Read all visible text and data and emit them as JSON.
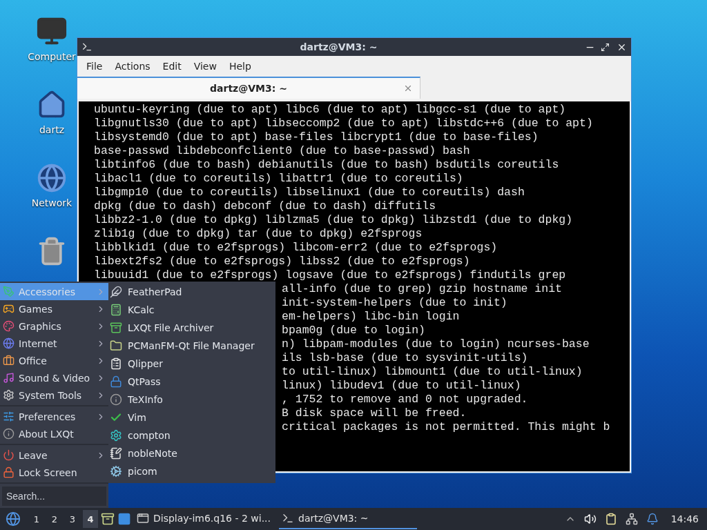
{
  "desktop_icons": [
    {
      "label": "Computer",
      "kind": "computer"
    },
    {
      "label": "dartz",
      "kind": "home"
    },
    {
      "label": "Network",
      "kind": "network"
    },
    {
      "kind": "trash"
    }
  ],
  "window": {
    "title": "dartz@VM3: ~",
    "menu": [
      "File",
      "Actions",
      "Edit",
      "View",
      "Help"
    ],
    "tabs": [
      {
        "label": "dartz@VM3: ~",
        "selected": true
      }
    ],
    "terminal": [
      {
        "text": "ubuntu-keyring (due to apt) libc6 (due to apt) libgcc-s1 (due to apt)",
        "kind": "full"
      },
      {
        "text": "libgnutls30 (due to apt) libseccomp2 (due to apt) libstdc++6 (due to apt)",
        "kind": "full"
      },
      {
        "text": "libsystemd0 (due to apt) base-files libcrypt1 (due to base-files)",
        "kind": "full"
      },
      {
        "text": "base-passwd libdebconfclient0 (due to base-passwd) bash",
        "kind": "full"
      },
      {
        "text": "libtinfo6 (due to bash) debianutils (due to bash) bsdutils coreutils",
        "kind": "full"
      },
      {
        "text": "libacl1 (due to coreutils) libattr1 (due to coreutils)",
        "kind": "full"
      },
      {
        "text": "libgmp10 (due to coreutils) libselinux1 (due to coreutils) dash",
        "kind": "full"
      },
      {
        "text": "dpkg (due to dash) debconf (due to dash) diffutils",
        "kind": "full"
      },
      {
        "text": "libbz2-1.0 (due to dpkg) liblzma5 (due to dpkg) libzstd1 (due to dpkg)",
        "kind": "full"
      },
      {
        "text": "zlib1g (due to dpkg) tar (due to dpkg) e2fsprogs",
        "kind": "full"
      },
      {
        "text": "libblkid1 (due to e2fsprogs) libcom-err2 (due to e2fsprogs)",
        "kind": "full"
      },
      {
        "text": "libext2fs2 (due to e2fsprogs) libss2 (due to e2fsprogs)",
        "kind": "full"
      },
      {
        "text": "libuuid1 (due to e2fsprogs) logsave (due to e2fsprogs) findutils grep",
        "kind": "full"
      },
      {
        "text": "all-info (due to grep) gzip hostname init",
        "kind": "partial"
      },
      {
        "text": "init-system-helpers (due to init)",
        "kind": "partial"
      },
      {
        "text": "em-helpers) libc-bin login",
        "kind": "partial"
      },
      {
        "text": "bpam0g (due to login)",
        "kind": "partial"
      },
      {
        "text": "n) libpam-modules (due to login) ncurses-base",
        "kind": "partial"
      },
      {
        "text": "ils lsb-base (due to sysvinit-utils)",
        "kind": "partial"
      },
      {
        "text": "to util-linux) libmount1 (due to util-linux)",
        "kind": "partial"
      },
      {
        "text": "linux) libudev1 (due to util-linux)",
        "kind": "partial"
      },
      {
        "text": ", 1752 to remove and 0 not upgraded.",
        "kind": "partial"
      },
      {
        "text": "B disk space will be freed.",
        "kind": "partial"
      },
      {
        "text": "critical packages is not permitted. This might b",
        "kind": "partial"
      }
    ]
  },
  "start_menu": {
    "groups": [
      [
        {
          "label": "Accessories",
          "selected": true,
          "submenu": true
        },
        {
          "label": "Games",
          "selected": false,
          "submenu": true
        },
        {
          "label": "Graphics",
          "selected": false,
          "submenu": true
        },
        {
          "label": "Internet",
          "selected": false,
          "submenu": true
        },
        {
          "label": "Office",
          "selected": false,
          "submenu": true
        },
        {
          "label": "Sound & Video",
          "selected": false,
          "submenu": true
        },
        {
          "label": "System Tools",
          "selected": false,
          "submenu": true
        }
      ],
      [
        {
          "label": "Preferences",
          "selected": false,
          "submenu": true
        },
        {
          "label": "About LXQt",
          "selected": false,
          "submenu": false
        }
      ],
      [
        {
          "label": "Leave",
          "selected": false,
          "submenu": true
        },
        {
          "label": "Lock Screen",
          "selected": false,
          "submenu": false
        }
      ]
    ],
    "search": {
      "placeholder": "Search..."
    },
    "submenu": [
      "FeatherPad",
      "KCalc",
      "LXQt File Archiver",
      "PCManFM-Qt File Manager",
      "Qlipper",
      "QtPass",
      "TeXInfo",
      "Vim",
      "compton",
      "nobleNote",
      "picom"
    ]
  },
  "taskbar": {
    "desktops": [
      {
        "label": "1",
        "selected": false
      },
      {
        "label": "2",
        "selected": false
      },
      {
        "label": "3",
        "selected": false
      },
      {
        "label": "4",
        "selected": true
      }
    ],
    "tasks": [
      {
        "label": "Display-im6.q16 - 2 wi...",
        "selected": false
      },
      {
        "label": "dartz@VM3: ~",
        "selected": true
      }
    ],
    "clock": "14:46"
  }
}
